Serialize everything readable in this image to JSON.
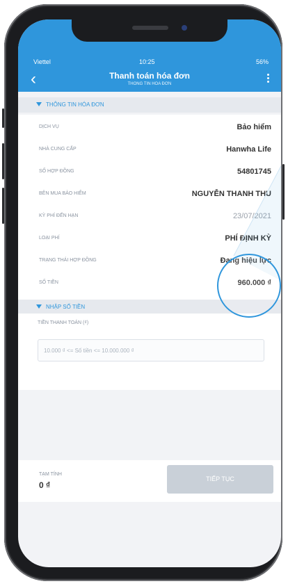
{
  "status_bar": {
    "carrier": "Viettel",
    "time": "10:25",
    "right": "56%"
  },
  "header": {
    "title": "Thanh toán hóa đơn",
    "subtitle": "THÔNG TIN HÓA ĐƠN"
  },
  "sections": {
    "info": "THÔNG TIN HÓA ĐƠN",
    "amount": "NHẬP SỐ TIỀN"
  },
  "rows": [
    {
      "label": "DỊCH VỤ",
      "value": "Bảo hiểm"
    },
    {
      "label": "NHÀ CUNG CẤP",
      "value": "Hanwha Life"
    },
    {
      "label": "SỐ HỢP ĐỒNG",
      "value": "54801745"
    },
    {
      "label": "BÊN MUA BẢO HIỂM",
      "value": "NGUYỄN THANH THU"
    },
    {
      "label": "KỲ PHÍ ĐẾN HẠN",
      "value": "23/07/2021"
    },
    {
      "label": "LOẠI PHÍ",
      "value": "PHÍ ĐỊNH KỲ"
    },
    {
      "label": "TRẠNG THÁI HỢP ĐỒNG",
      "value": "Đang hiệu lực"
    },
    {
      "label": "SỐ TIỀN",
      "value": "960.000 ₫"
    }
  ],
  "input": {
    "label": "TIỀN THANH TOÁN (₫)",
    "placeholder": "10.000 ₫ <= Số tiền <= 10.000.000 ₫"
  },
  "footer": {
    "label": "TẠM TÍNH",
    "amount": "0 ₫",
    "button": "TIẾP TỤC"
  },
  "colors": {
    "accent": "#2f96dc",
    "disabled": "#c9d0d8"
  }
}
